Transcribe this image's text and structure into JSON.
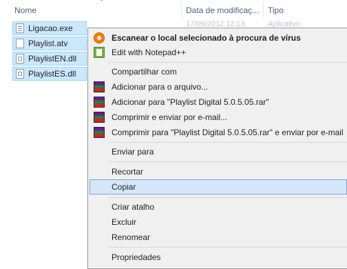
{
  "columns": {
    "name": "Nome",
    "date": "Data de modificaç...",
    "type": "Tipo"
  },
  "files": [
    {
      "name": "Ligacao.exe",
      "icon": "exe-file-icon",
      "ghost_date": "17/09/2012 12:13",
      "ghost_type": "Aplicativo"
    },
    {
      "name": "Playlist.atv",
      "icon": "generic-file-icon",
      "ghost_date": "",
      "ghost_type": ""
    },
    {
      "name": "PlaylistEN.dll",
      "icon": "dll-file-icon",
      "ghost_date": "",
      "ghost_type": ""
    },
    {
      "name": "PlaylistES.dll",
      "icon": "dll-file-icon",
      "ghost_date": "",
      "ghost_type": ""
    }
  ],
  "menu": {
    "scan": "Escanear o local selecionado à procura de vírus",
    "notepad": "Edit with Notepad++",
    "share": "Compartilhar com",
    "add_archive": "Adicionar para o arquivo...",
    "add_rar": "Adicionar para \"Playlist Digital 5.0.5.05.rar\"",
    "compress_email": "Comprimir e enviar por e-mail...",
    "compress_rar_email": "Comprimir para \"Playlist Digital 5.0.5.05.rar\" e enviar por e-mail",
    "send_to": "Enviar para",
    "cut": "Recortar",
    "copy": "Copiar",
    "shortcut": "Criar atalho",
    "delete": "Excluir",
    "rename": "Renomear",
    "properties": "Propriedades"
  },
  "colors": {
    "menu_bg": "#f0f0f0",
    "hover_bg": "#d5e7f8",
    "selection_bg": "#cce8ff",
    "header_text": "#4c607a"
  }
}
